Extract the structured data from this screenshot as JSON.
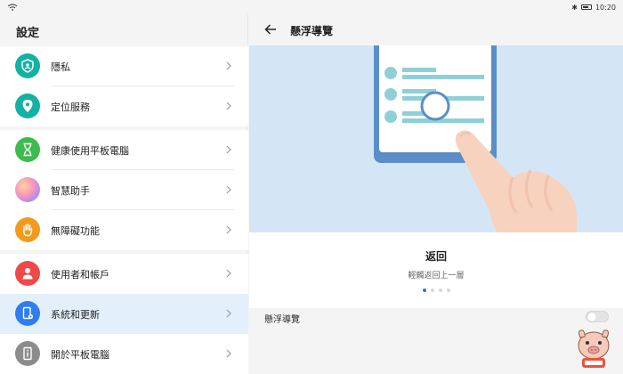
{
  "status": {
    "time": "10:20",
    "bluetooth_glyph": "✱"
  },
  "left": {
    "title": "設定",
    "groups": [
      {
        "items": [
          {
            "label": "隱私",
            "icon": "shield-person-icon",
            "color": "#12b1a4"
          },
          {
            "label": "定位服務",
            "icon": "location-pin-icon",
            "color": "#12b1a4"
          }
        ]
      },
      {
        "items": [
          {
            "label": "健康使用平板電腦",
            "icon": "hourglass-icon",
            "color": "#3dbb4e"
          },
          {
            "label": "智慧助手",
            "icon": "assistant-orb-icon",
            "color": "#c58ce8"
          },
          {
            "label": "無障礙功能",
            "icon": "hand-icon",
            "color": "#f29a1c"
          }
        ]
      },
      {
        "items": [
          {
            "label": "使用者和帳戶",
            "icon": "person-icon",
            "color": "#f04848"
          },
          {
            "label": "系統和更新",
            "icon": "tablet-gear-icon",
            "color": "#2f7df0"
          },
          {
            "label": "開於平板電腦",
            "icon": "tablet-info-icon",
            "color": "#8c8c8c"
          }
        ]
      }
    ]
  },
  "right": {
    "title": "懸浮導覽",
    "gesture_title": "返回",
    "gesture_desc": "輕觸返回上一層",
    "pager": {
      "count": 4,
      "active": 0
    },
    "setting_label": "懸浮導覽",
    "toggle_on": false
  },
  "colors": {
    "selected_bg": "#e3f0fc",
    "accent": "#1a7ae8",
    "illustration_bg": "#d4e6f5"
  }
}
